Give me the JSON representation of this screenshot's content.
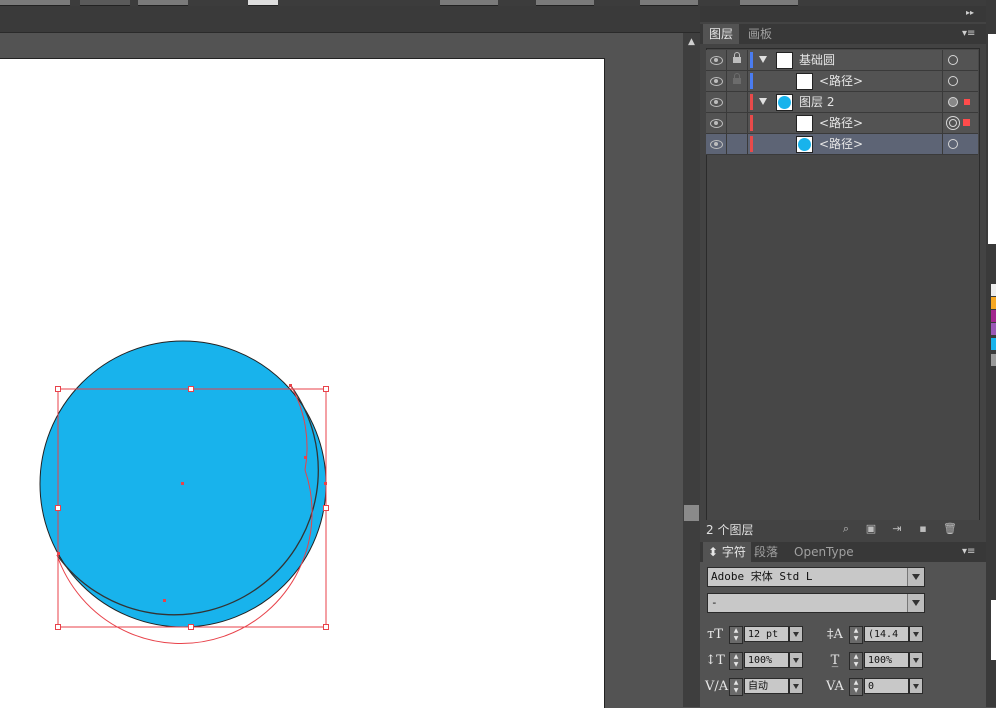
{
  "colors": {
    "fill": "#18b3ec",
    "bounding_box": "#e8424a",
    "layer_blue": "#4a7cf0",
    "layer_red": "#e84a4a",
    "selected_row": "#5d6475"
  },
  "layers_panel": {
    "tabs": [
      {
        "label": "图层",
        "active": true
      },
      {
        "label": "画板",
        "active": false
      }
    ],
    "rows": [
      {
        "name": "基础圆",
        "type": "layer",
        "expanded": true,
        "locked": true,
        "color": "blue",
        "thumb": "empty",
        "target": "ring",
        "selected": false
      },
      {
        "name": "<路径>",
        "type": "path",
        "locked_dim": true,
        "color": "blue",
        "thumb": "empty",
        "target": "ring",
        "selected": false
      },
      {
        "name": "图层 2",
        "type": "layer",
        "expanded": true,
        "color": "red",
        "thumb": "circle",
        "target": "filled-ring",
        "selected": false
      },
      {
        "name": "<路径>",
        "type": "path",
        "color": "red",
        "thumb": "empty",
        "target": "double-ring",
        "selected": false
      },
      {
        "name": "<路径>",
        "type": "path",
        "color": "red",
        "thumb": "circle",
        "target": "ring",
        "selected": true
      }
    ],
    "footer": {
      "count_label": "2 个图层",
      "icons": [
        "locate-icon",
        "clipping-mask-icon",
        "new-sublayer-icon",
        "new-layer-icon",
        "delete-icon"
      ]
    }
  },
  "character_panel": {
    "tabs": [
      {
        "label": "字符",
        "active": true
      },
      {
        "label": "段落",
        "active": false
      },
      {
        "label": "OpenType",
        "active": false
      }
    ],
    "font_family": "Adobe 宋体 Std L",
    "font_style": "-",
    "font_size": "12 pt",
    "leading": "(14.4",
    "vertical_scale": "100%",
    "horizontal_scale": "100%",
    "kerning": "自动",
    "tracking": "0"
  }
}
